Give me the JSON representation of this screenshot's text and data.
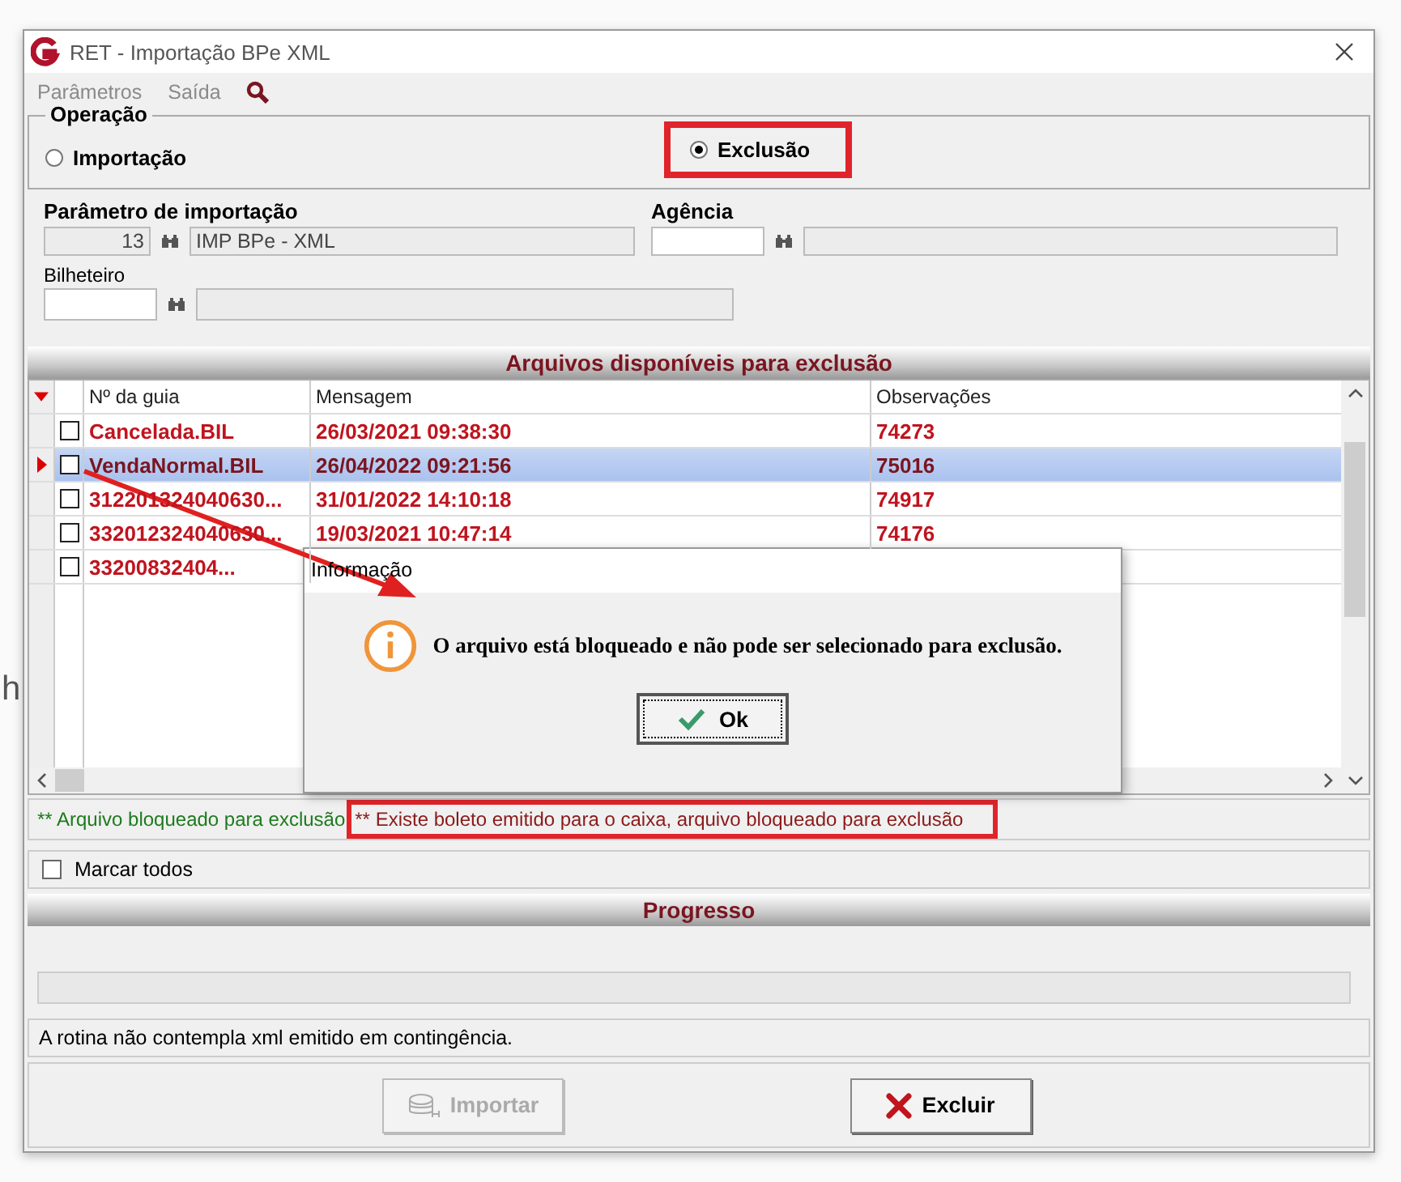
{
  "background_text": "h",
  "window": {
    "title": "RET - Importação BPe XML"
  },
  "menu": [
    {
      "label": "Parâmetros"
    },
    {
      "label": "Saída"
    }
  ],
  "operation": {
    "title": "Operação",
    "options": [
      {
        "label": "Importação",
        "selected": false,
        "highlighted": false
      },
      {
        "label": "Exclusão",
        "selected": true,
        "highlighted": true
      }
    ]
  },
  "params": {
    "parametro_label": "Parâmetro de importação",
    "parametro_code": "13",
    "parametro_name": "IMP BPe - XML",
    "agencia_label": "Agência",
    "bilheteiro_label": "Bilheteiro"
  },
  "grid": {
    "title": "Arquivos disponíveis para exclusão",
    "columns": [
      "Nº da guia",
      "Mensagem",
      "Observações"
    ],
    "rows": [
      {
        "selected": false,
        "checked": false,
        "cells": [
          "Cancelada.BIL",
          "26/03/2021 09:38:30",
          "74273"
        ]
      },
      {
        "selected": true,
        "checked": false,
        "cells": [
          "VendaNormal.BIL",
          "26/04/2022 09:21:56",
          "75016"
        ]
      },
      {
        "selected": false,
        "checked": false,
        "cells": [
          "312201324040630...",
          "31/01/2022 14:10:18",
          "74917"
        ]
      },
      {
        "selected": false,
        "checked": false,
        "cells": [
          "332012324040630...",
          "19/03/2021 10:47:14",
          "74176"
        ]
      },
      {
        "selected": false,
        "checked": false,
        "cells": [
          "33200832404..."
        ]
      }
    ]
  },
  "legend": [
    {
      "text": "** Arquivo bloqueado para exclusão",
      "color": "#1e7a1e",
      "highlighted": false
    },
    {
      "text": "** Existe boleto emitido para o caixa, arquivo bloqueado para exclusão",
      "color": "#8b1a1a",
      "highlighted": true
    }
  ],
  "select_all": {
    "label": "Marcar todos",
    "checked": false
  },
  "progress": {
    "title": "Progresso",
    "level": 0
  },
  "info": "A rotina não contempla xml emitido em contingência.",
  "buttons": [
    {
      "label": "Importar",
      "kind": "import",
      "disabled": true
    },
    {
      "label": "Excluir",
      "kind": "delete",
      "disabled": false
    }
  ],
  "dialog": {
    "title": "Informação",
    "message": "O arquivo está bloqueado e não pode ser selecionado para exclusão.",
    "button": "Ok"
  },
  "arrow_annotation": true
}
